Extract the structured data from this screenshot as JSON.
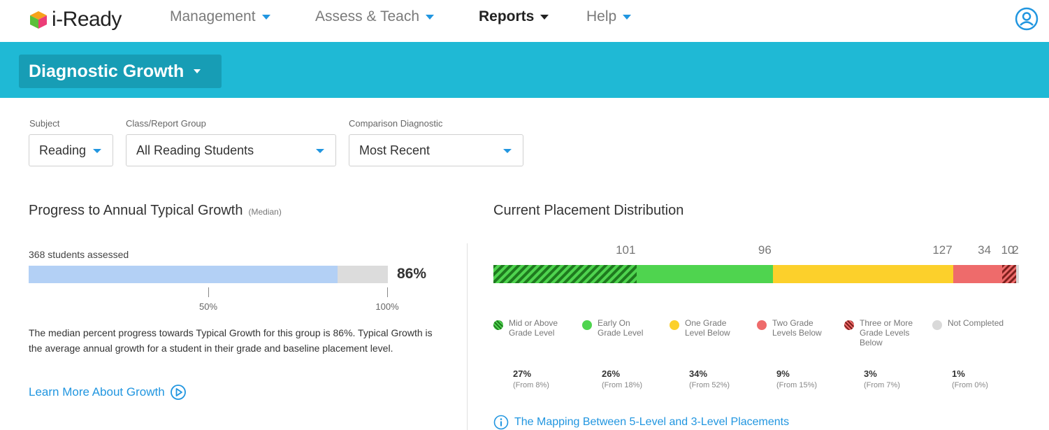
{
  "topnav": {
    "logo_text": "i-Ready",
    "items": [
      {
        "label": "Management",
        "active": false
      },
      {
        "label": "Assess & Teach",
        "active": false
      },
      {
        "label": "Reports",
        "active": true
      },
      {
        "label": "Help",
        "active": false
      }
    ],
    "user_icon": "user-circle-icon"
  },
  "banner": {
    "report_title": "Diagnostic Growth",
    "color": "#1fb9d5"
  },
  "filters": {
    "subject": {
      "label": "Subject",
      "value": "Reading"
    },
    "group": {
      "label": "Class/Report Group",
      "value": "All Reading Students"
    },
    "comparison": {
      "label": "Comparison Diagnostic",
      "value": "Most Recent"
    }
  },
  "progress": {
    "title": "Progress to Annual Typical Growth",
    "title_note": "(Median)",
    "students_assessed": "368 students assessed",
    "percent_value": 86,
    "percent_label": "86%",
    "tick_labels": [
      "50%",
      "100%"
    ],
    "description": "The median percent progress towards Typical Growth for this group is 86%. Typical Growth is the average annual growth for a student in their grade and baseline placement level.",
    "learn_more": "Learn More About Growth"
  },
  "distribution": {
    "title": "Current Placement Distribution",
    "categories": [
      {
        "name": "Mid or Above Grade Level",
        "count": "101",
        "percent": "27%",
        "from": "(From 8%)",
        "color": "#2e9e2e",
        "hatched": true
      },
      {
        "name": "Early On Grade Level",
        "count": "96",
        "percent": "26%",
        "from": "(From 18%)",
        "color": "#4fd44f",
        "hatched": false
      },
      {
        "name": "One Grade Level Below",
        "count": "127",
        "percent": "34%",
        "from": "(From 52%)",
        "color": "#fcd02b",
        "hatched": false
      },
      {
        "name": "Two Grade Levels Below",
        "count": "34",
        "percent": "9%",
        "from": "(From 15%)",
        "color": "#ee6b6b",
        "hatched": false
      },
      {
        "name": "Three or More Grade Levels Below",
        "count": "10",
        "percent": "3%",
        "from": "(From 7%)",
        "color": "#c9413d",
        "hatched": true
      },
      {
        "name": "Not Completed",
        "count": "2",
        "percent": "1%",
        "from": "(From 0%)",
        "color": "#d9d9d9",
        "hatched": false
      }
    ],
    "mapping_link": "The Mapping Between 5-Level and 3-Level Placements"
  }
}
